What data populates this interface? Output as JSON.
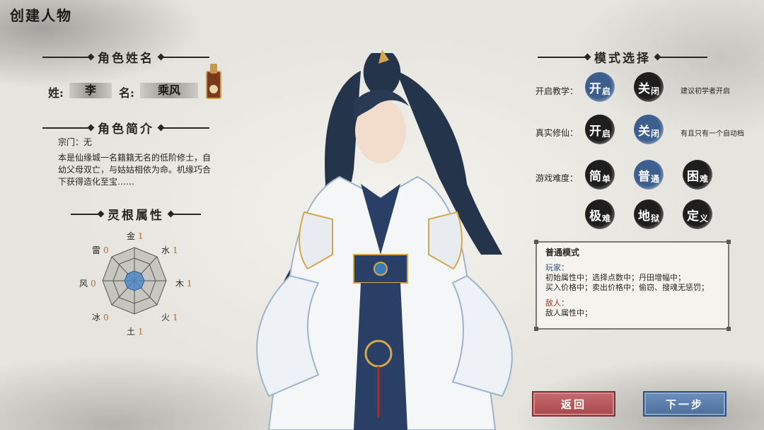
{
  "title": "创建人物",
  "name_section": {
    "heading": "角色姓名",
    "surname_label": "姓:",
    "surname_value": "李",
    "given_label": "名:",
    "given_value": "乘风"
  },
  "bio_section": {
    "heading": "角色简介",
    "sect": "宗门：无",
    "description": "本是仙缘城一名籍籍无名的低阶修士，自幼父母双亡，与姑姑相依为命。机缘巧合下获得造化至宝……"
  },
  "roots_section": {
    "heading": "灵根属性",
    "attributes": [
      {
        "name": "金",
        "value": "1"
      },
      {
        "name": "水",
        "value": "1"
      },
      {
        "name": "木",
        "value": "1"
      },
      {
        "name": "火",
        "value": "1"
      },
      {
        "name": "土",
        "value": "1"
      },
      {
        "name": "冰",
        "value": "0"
      },
      {
        "name": "风",
        "value": "0"
      },
      {
        "name": "雷",
        "value": "0"
      }
    ]
  },
  "mode_section": {
    "heading": "模式选择",
    "tutorial": {
      "label": "开启教学：",
      "on": "开",
      "on_s": "启",
      "off": "关",
      "off_s": "闭",
      "hint": "建议初学者开启",
      "selected": "on"
    },
    "real_mode": {
      "label": "真实修仙：",
      "on": "开",
      "on_s": "启",
      "off": "关",
      "off_s": "闭",
      "hint": "有且只有一个自动档",
      "selected": "off"
    },
    "difficulty": {
      "label": "游戏难度：",
      "options": [
        {
          "main": "简",
          "sub": "单"
        },
        {
          "main": "普",
          "sub": "通"
        },
        {
          "main": "困",
          "sub": "难"
        },
        {
          "main": "极",
          "sub": "难"
        },
        {
          "main": "地",
          "sub": "狱"
        },
        {
          "main": "定",
          "sub": "义"
        }
      ],
      "selected": "普通"
    }
  },
  "info_box": {
    "title": "普通模式",
    "player_label": "玩家：",
    "player_line1": "初始属性中；选择点数中；丹田增幅中；",
    "player_line2": "买入价格中；卖出价格中；偷窃、搜魂无惩罚；",
    "enemy_label": "敌人：",
    "enemy_line1": "敌人属性中；"
  },
  "buttons": {
    "back": "返回",
    "next": "下一步"
  },
  "colors": {
    "accent_blue": "#3d5f8f",
    "back_red": "#b4525a",
    "next_blue": "#5a7dab",
    "value_orange": "#b86a2a"
  }
}
